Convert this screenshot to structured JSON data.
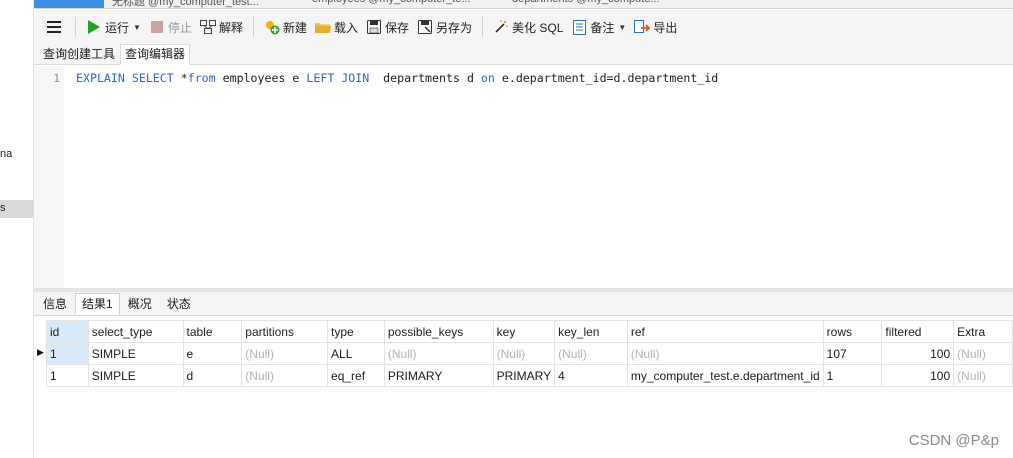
{
  "sidebar": {
    "frag1": "na",
    "frag2": "s"
  },
  "top_tabs": [
    {
      "label": "无标题 @my_computer_test..."
    },
    {
      "label": "employees @my_computer_te..."
    },
    {
      "label": "departments @my_compute..."
    }
  ],
  "toolbar": {
    "menu_icon": "hamburger-icon",
    "run": "运行",
    "stop": "停止",
    "explain": "解释",
    "new": "新建",
    "load": "载入",
    "save": "保存",
    "save_as": "另存为",
    "beautify": "美化 SQL",
    "notes": "备注",
    "export": "导出"
  },
  "subtabs": {
    "builder": "查询创建工具",
    "editor": "查询编辑器"
  },
  "editor": {
    "line_number": "1",
    "sql": {
      "t1": "EXPLAIN",
      "t2": "SELECT",
      "t3": " *",
      "t4": "from",
      "t5": " employees e ",
      "t6": "LEFT JOIN",
      "t7": "  departments d ",
      "t8": "on",
      "t9": " e.department_id=d.department_id"
    }
  },
  "result_tabs": {
    "info": "信息",
    "result1": "结果1",
    "overview": "概况",
    "status": "状态"
  },
  "grid": {
    "columns": [
      "id",
      "select_type",
      "table",
      "partitions",
      "type",
      "possible_keys",
      "key",
      "key_len",
      "ref",
      "rows",
      "filtered",
      "Extra"
    ],
    "rows": [
      [
        "1",
        "SIMPLE",
        "e",
        "(Null)",
        "ALL",
        "(Null)",
        "(Null)",
        "(Null)",
        "(Null)",
        "107",
        "100",
        "(Null)"
      ],
      [
        "1",
        "SIMPLE",
        "d",
        "(Null)",
        "eq_ref",
        "PRIMARY",
        "PRIMARY",
        "4",
        "my_computer_test.e.department_id",
        "1",
        "100",
        "(Null)"
      ]
    ]
  },
  "watermark": "CSDN @P&p",
  "colors": {
    "keyword": "#2b65d9",
    "selection": "#d9ebfb",
    "run_green": "#1ea51e"
  }
}
